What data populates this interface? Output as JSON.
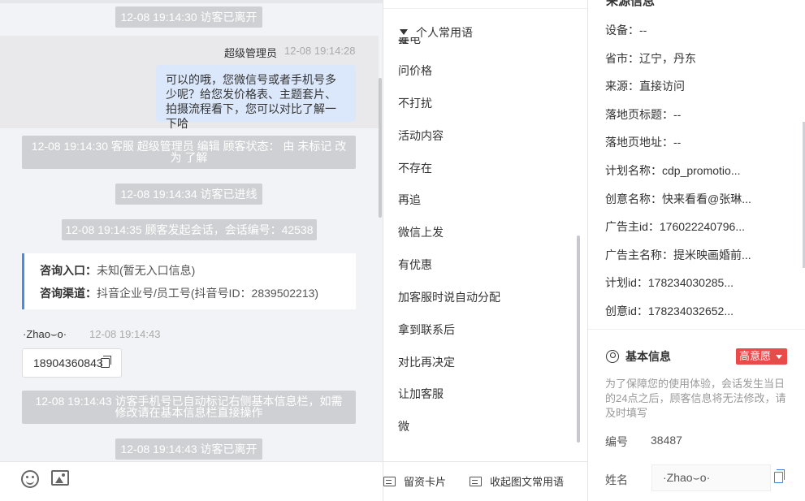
{
  "chat": {
    "sys_msgs": [
      "12-08 19:14:30 访客已离开",
      "12-08 19:14:30 客服 超级管理员 编辑 顾客状态： 由 未标记 改为 了解",
      "12-08 19:14:34 访客已进线",
      "12-08 19:14:35 顾客发起会话，会话编号：42538",
      "12-08 19:14:43 访客手机号已自动标记右侧基本信息栏，如需修改请在基本信息栏直接操作",
      "12-08 19:14:43 访客已离开"
    ],
    "agent_name": "超级管理员",
    "agent_time": "12-08 19:14:28",
    "agent_message": "可以的哦，您微信号或者手机号多少呢？给您发价格表、主题套片、拍摄流程看下，您可以对比了解一下哈",
    "info_card": {
      "entry_label": "咨询入口：",
      "entry_value": "未知(暂无入口信息)",
      "channel_label": "咨询渠道：",
      "channel_value": "抖音企业号/员工号(抖音号ID：2839502213)"
    },
    "visitor_name": "·Zhao⌣o·󠄀󠄀",
    "visitor_time": "12-08 19:14:43",
    "visitor_phone": "18904360843",
    "tools": [
      "emoji-icon",
      "image-icon"
    ]
  },
  "phrases": {
    "header": "个人常用语",
    "cut_item": "要电话",
    "items": [
      "问价格",
      "不打扰",
      "活动内容",
      "不存在",
      "再追",
      "微信上发",
      "有优惠",
      "加客服时说自动分配",
      "拿到联系后",
      "对比再决定",
      "让加客服",
      "微"
    ],
    "footer": {
      "card_label": "留资卡片",
      "collapse_label": "收起图文常用语"
    }
  },
  "info": {
    "source_title": "来源信息",
    "source_items": [
      "设备：--",
      "省市：辽宁，丹东",
      "来源：直接访问",
      "落地页标题：--",
      "落地页地址：--",
      "计划名称：cdp_promotio...",
      "创意名称：快来看看@张琳...",
      "广告主id：176022240796...",
      "广告主名称：提米映画婚前...",
      "计划id：178234030285...",
      "创意id：178234032652..."
    ],
    "basic_title": "基本信息",
    "intent_badge": "高意愿",
    "notice": "为了保障您的使用体验，会话发生当日的24点之后，顾客信息将无法修改，请及时填写",
    "number_label": "编号",
    "number_value": "38487",
    "name_label": "姓名",
    "name_value": "·Zhao⌣o·󠄀󠄀"
  },
  "colors": {
    "accent_blue": "#4a8be6",
    "badge_red": "#e94b4b",
    "agent_bubble": "#dbe8fb",
    "system_gray": "#cfd0d3"
  }
}
